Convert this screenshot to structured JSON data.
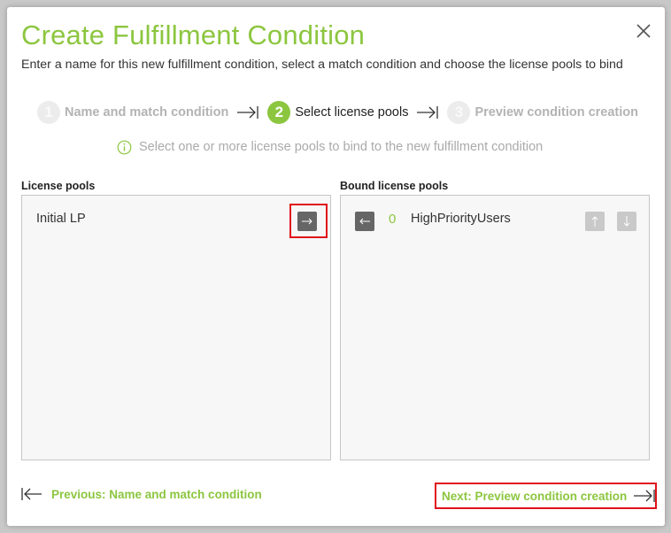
{
  "dialog": {
    "title": "Create Fulfillment Condition",
    "subtitle": "Enter a name for this new fulfillment condition, select a match condition and choose the license pools to bind"
  },
  "steps": [
    {
      "number": "1",
      "label": "Name and match condition",
      "state": "done"
    },
    {
      "number": "2",
      "label": "Select license pools",
      "state": "active"
    },
    {
      "number": "3",
      "label": "Preview condition creation",
      "state": "future"
    }
  ],
  "hint": "Select one or more license pools to bind to the new fulfillment condition",
  "license_pools": {
    "label": "License pools",
    "items": [
      {
        "name": "Initial LP"
      }
    ]
  },
  "bound_pools": {
    "label": "Bound license pools",
    "items": [
      {
        "priority": "0",
        "name": "HighPriorityUsers"
      }
    ]
  },
  "nav": {
    "previous_label": "Previous: Name and match condition",
    "next_label": "Next: Preview condition creation"
  },
  "colors": {
    "accent": "#8cc63f",
    "highlight": "#e0121b"
  },
  "icons": {
    "close": "close-icon",
    "info": "info-icon",
    "step_arrow": "arrow-to-bar-icon",
    "add": "arrow-right-icon",
    "remove": "arrow-left-icon",
    "up": "arrow-up-icon",
    "down": "arrow-down-icon"
  }
}
